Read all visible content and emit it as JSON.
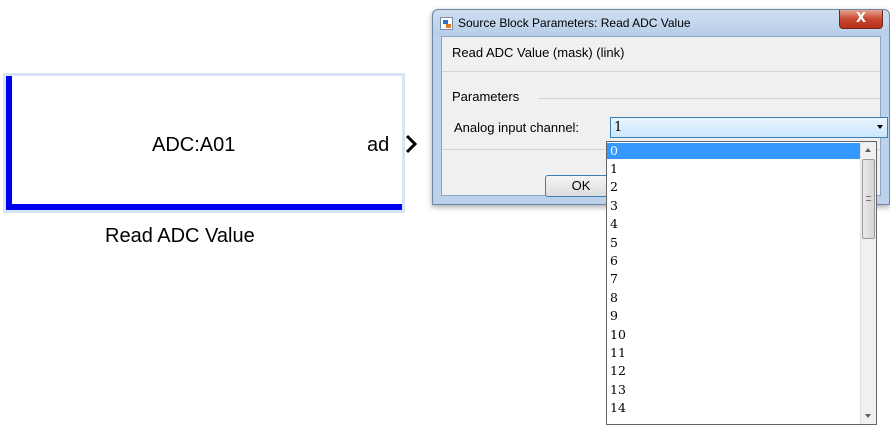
{
  "block": {
    "main_label": "ADC:A01",
    "port_label": "ad",
    "caption": "Read ADC Value",
    "accent_color": "#0000f0"
  },
  "dialog": {
    "title": "Source Block Parameters: Read ADC Value",
    "close_symbol": "X",
    "description": "Read ADC Value (mask) (link)",
    "params_header": "Parameters",
    "field_label": "Analog input channel:",
    "selected_value": "1",
    "ok_label": "OK"
  },
  "dropdown": {
    "options": [
      "0",
      "1",
      "2",
      "3",
      "4",
      "5",
      "6",
      "7",
      "8",
      "9",
      "10",
      "11",
      "12",
      "13",
      "14"
    ],
    "highlighted": "0",
    "highlight_color": "#3399ff"
  }
}
